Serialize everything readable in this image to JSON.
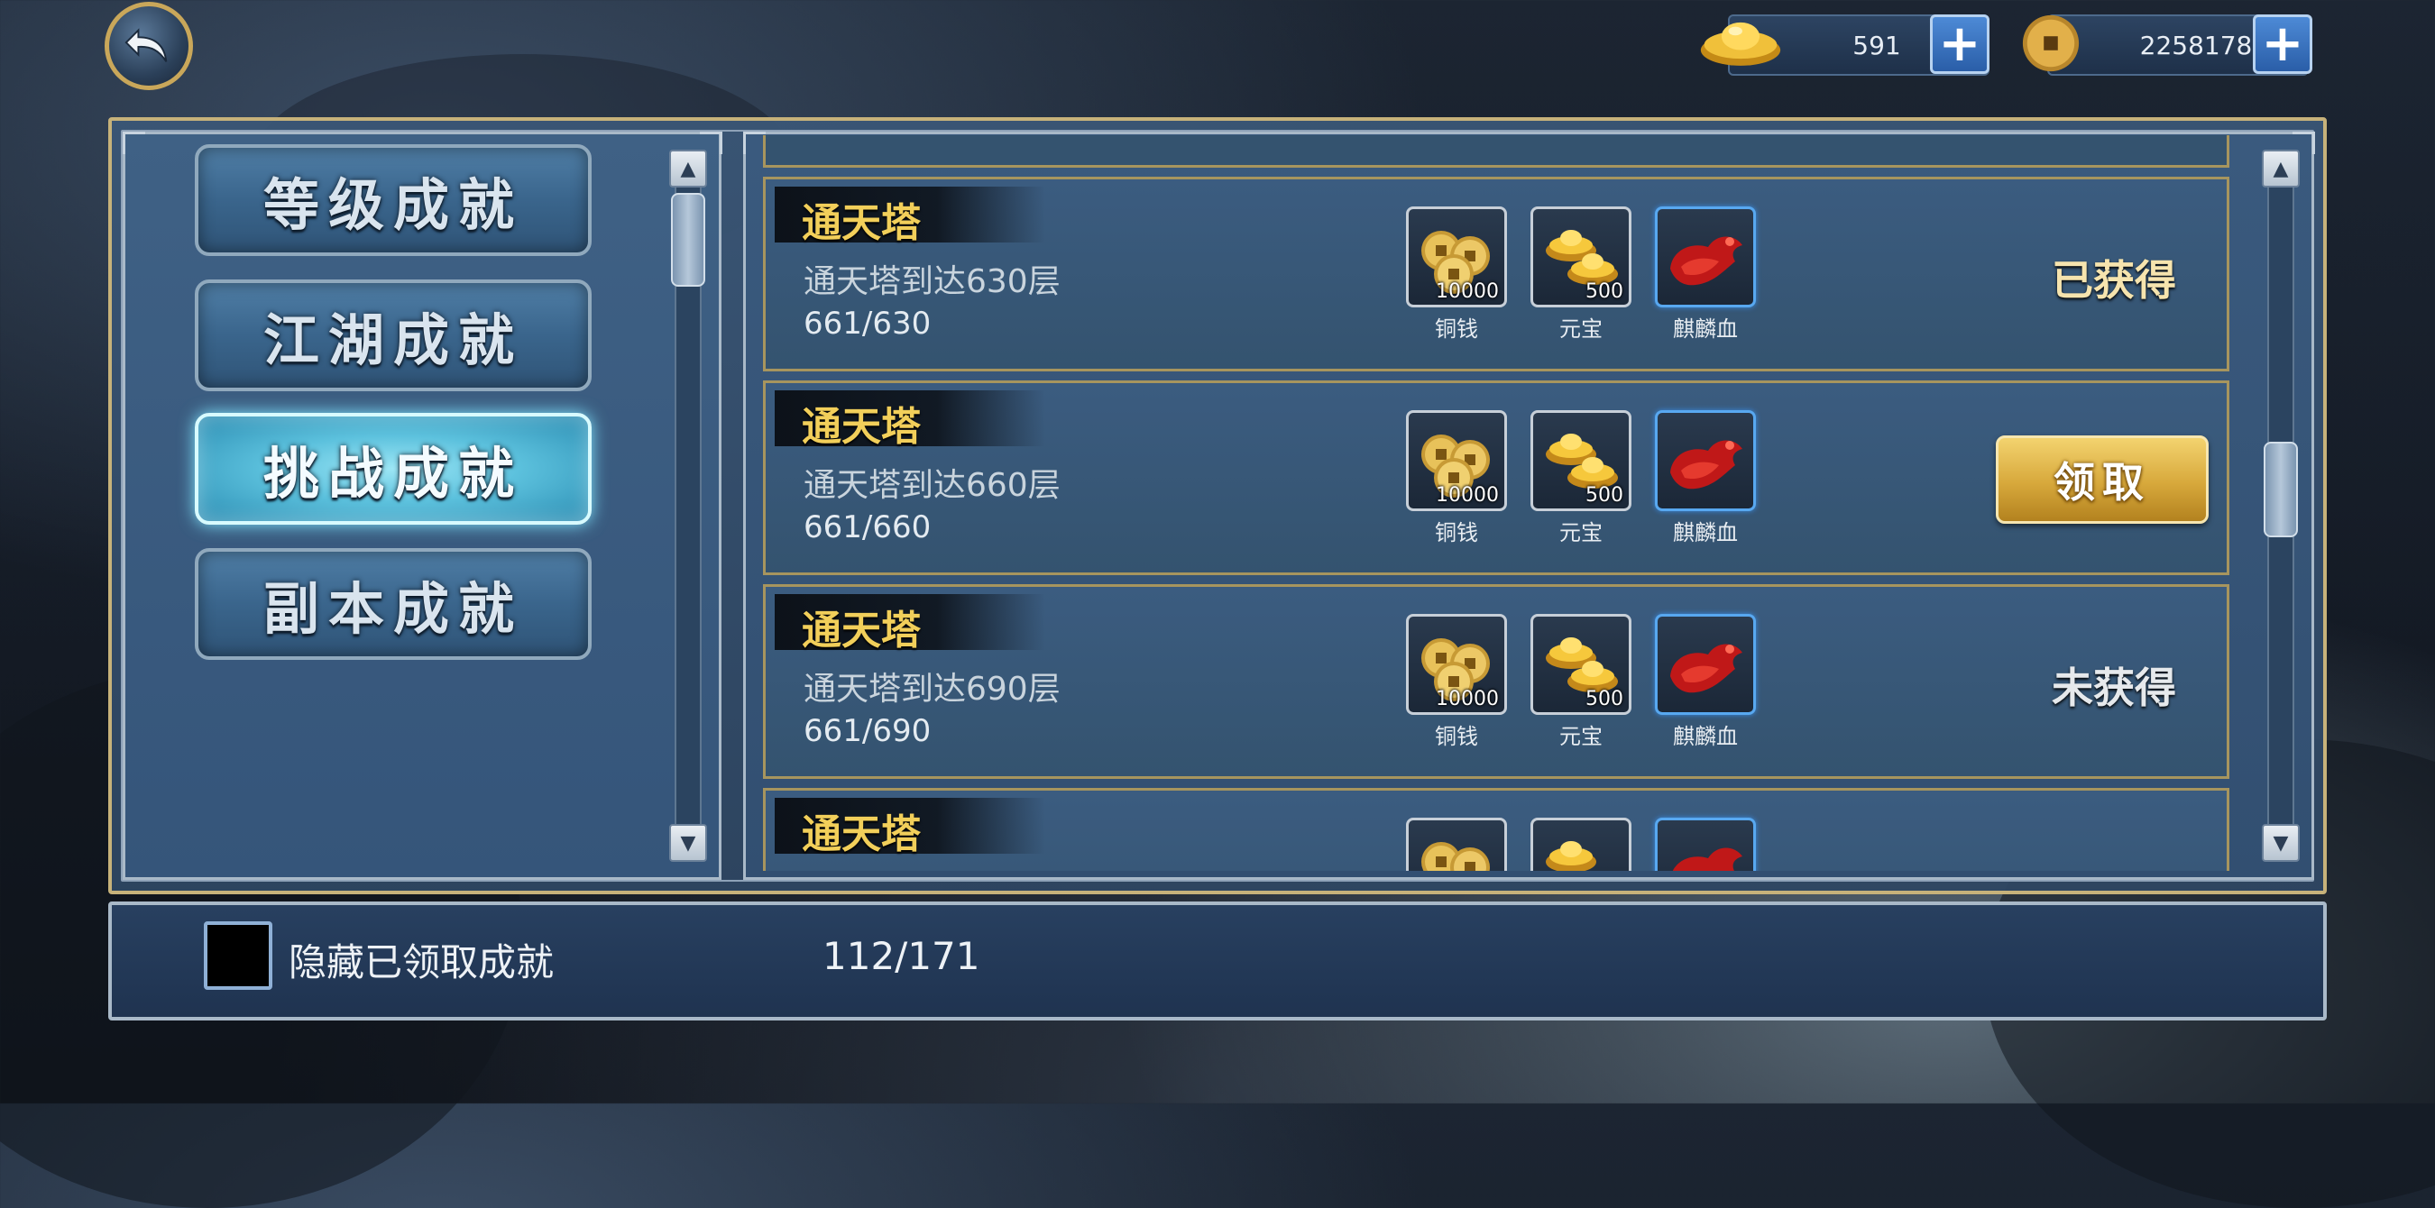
{
  "header": {
    "back_icon": "back-arrow-icon",
    "currencies": [
      {
        "icon": "gold-ingot-icon",
        "value": "591"
      },
      {
        "icon": "copper-coin-icon",
        "value": "2258178"
      }
    ],
    "plus_label": "+"
  },
  "categories": [
    {
      "label": "等级成就",
      "active": false
    },
    {
      "label": "江湖成就",
      "active": false
    },
    {
      "label": "挑战成就",
      "active": true
    },
    {
      "label": "副本成就",
      "active": false
    }
  ],
  "achievements": [
    {
      "title": "通天塔",
      "desc": "通天塔到达630层",
      "progress": "661/630",
      "rewards": [
        {
          "name": "铜钱",
          "qty": "10000",
          "icon": "copper-coins-icon"
        },
        {
          "name": "元宝",
          "qty": "500",
          "icon": "gold-ingot-icon"
        },
        {
          "name": "麒麟血",
          "qty": "",
          "icon": "qilin-blood-icon"
        }
      ],
      "status": "已获得",
      "status_type": "got"
    },
    {
      "title": "通天塔",
      "desc": "通天塔到达660层",
      "progress": "661/660",
      "rewards": [
        {
          "name": "铜钱",
          "qty": "10000",
          "icon": "copper-coins-icon"
        },
        {
          "name": "元宝",
          "qty": "500",
          "icon": "gold-ingot-icon"
        },
        {
          "name": "麒麟血",
          "qty": "",
          "icon": "qilin-blood-icon"
        }
      ],
      "status": "领取",
      "status_type": "claim"
    },
    {
      "title": "通天塔",
      "desc": "通天塔到达690层",
      "progress": "661/690",
      "rewards": [
        {
          "name": "铜钱",
          "qty": "10000",
          "icon": "copper-coins-icon"
        },
        {
          "name": "元宝",
          "qty": "500",
          "icon": "gold-ingot-icon"
        },
        {
          "name": "麒麟血",
          "qty": "",
          "icon": "qilin-blood-icon"
        }
      ],
      "status": "未获得",
      "status_type": "not"
    },
    {
      "title": "通天塔",
      "desc": "",
      "progress": "",
      "rewards": [
        {
          "name": "",
          "qty": "",
          "icon": "copper-coins-icon"
        },
        {
          "name": "",
          "qty": "",
          "icon": "gold-ingot-icon"
        },
        {
          "name": "",
          "qty": "",
          "icon": "qilin-blood-icon"
        }
      ],
      "status": "",
      "status_type": "not"
    }
  ],
  "footer": {
    "hide_claimed_label": "隐藏已领取成就",
    "hide_claimed_checked": false,
    "count": "112/171"
  },
  "colors": {
    "title_gold": "#f2cf5a",
    "active_tab": "#5cc1dd",
    "claim_button": "#d7a83b"
  }
}
